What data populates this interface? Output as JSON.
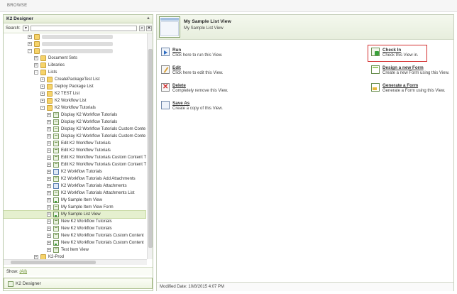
{
  "ribbon": {
    "label": "BROWSE"
  },
  "left_panel": {
    "title": "K2 Designer",
    "search_label": "Search:",
    "tree": [
      {
        "label": "",
        "kind": "folder",
        "indent": 1,
        "exp": "+",
        "blurred": true
      },
      {
        "label": "",
        "kind": "folder",
        "indent": 1,
        "exp": "+",
        "blurred": true
      },
      {
        "label": "",
        "kind": "folder",
        "indent": 1,
        "exp": "-",
        "blurred": true
      },
      {
        "label": "Document Sets",
        "kind": "folder",
        "indent": 2,
        "exp": "+"
      },
      {
        "label": "Libraries",
        "kind": "folder",
        "indent": 2,
        "exp": "+"
      },
      {
        "label": "Lists",
        "kind": "folder",
        "indent": 2,
        "exp": "-"
      },
      {
        "label": "CreatePackageTest List",
        "kind": "folder",
        "indent": 3,
        "exp": "+"
      },
      {
        "label": "Deploy Package List",
        "kind": "folder",
        "indent": 3,
        "exp": "+"
      },
      {
        "label": "K2 TEST List",
        "kind": "folder",
        "indent": 3,
        "exp": "+"
      },
      {
        "label": "K2 Workflow List",
        "kind": "folder",
        "indent": 3,
        "exp": "+"
      },
      {
        "label": "K2 Workflow Tutorials",
        "kind": "folder",
        "indent": 3,
        "exp": "-"
      },
      {
        "label": "Display K2 Workflow Tutorials",
        "kind": "view",
        "indent": 4,
        "exp": "+"
      },
      {
        "label": "Display K2 Workflow Tutorials",
        "kind": "view",
        "indent": 4,
        "exp": "+"
      },
      {
        "label": "Display K2 Workflow Tutorials Custom Conte",
        "kind": "view",
        "indent": 4,
        "exp": "+"
      },
      {
        "label": "Display K2 Workflow Tutorials Custom Conte",
        "kind": "view",
        "indent": 4,
        "exp": "+"
      },
      {
        "label": "Edit K2 Workflow Tutorials",
        "kind": "view",
        "indent": 4,
        "exp": "+"
      },
      {
        "label": "Edit K2 Workflow Tutorials",
        "kind": "view",
        "indent": 4,
        "exp": "+"
      },
      {
        "label": "Edit K2 Workflow Tutorials Custom Content T",
        "kind": "view",
        "indent": 4,
        "exp": "+"
      },
      {
        "label": "Edit K2 Workflow Tutorials Custom Content T",
        "kind": "view",
        "indent": 4,
        "exp": "+"
      },
      {
        "label": "K2 Workflow Tutorials",
        "kind": "smartobj",
        "indent": 4,
        "exp": "+"
      },
      {
        "label": "K2 Workflow Tutorials Add Attachments",
        "kind": "view",
        "indent": 4,
        "exp": "+"
      },
      {
        "label": "K2 Workflow Tutorials Attachments",
        "kind": "smartobj",
        "indent": 4,
        "exp": "+"
      },
      {
        "label": "K2 Workflow Tutorials Attachments List",
        "kind": "view",
        "indent": 4,
        "exp": "+"
      },
      {
        "label": "My Sample Item View",
        "kind": "form",
        "indent": 4,
        "exp": "+"
      },
      {
        "label": "My Sample Item View Form",
        "kind": "view",
        "indent": 4,
        "exp": "+"
      },
      {
        "label": "My Sample List View",
        "kind": "form",
        "indent": 4,
        "exp": "+",
        "selected": true
      },
      {
        "label": "New K2 Workflow Tutorials",
        "kind": "view",
        "indent": 4,
        "exp": "+"
      },
      {
        "label": "New K2 Workflow Tutorials",
        "kind": "view",
        "indent": 4,
        "exp": "+"
      },
      {
        "label": "New K2 Workflow Tutorials Custom Content",
        "kind": "view",
        "indent": 4,
        "exp": "+"
      },
      {
        "label": "New K2 Workflow Tutorials Custom Content",
        "kind": "form",
        "indent": 4,
        "exp": "+"
      },
      {
        "label": "Test Item View",
        "kind": "view",
        "indent": 4,
        "exp": "+"
      },
      {
        "label": "K2-Prod",
        "kind": "folder",
        "indent": 2,
        "exp": "+"
      }
    ],
    "show_label": "Show:",
    "show_link": "(All)",
    "designer_tab": "K2 Designer"
  },
  "right_panel": {
    "title": "My Sample List View",
    "subtitle": "My Sample List View",
    "actions_left": [
      {
        "title": "Run",
        "desc": "Click here to run this View.",
        "icon": "run"
      },
      {
        "title": "Edit",
        "desc": "Click here to edit this View.",
        "icon": "edit"
      },
      {
        "title": "Delete",
        "desc": "Completely remove this View.",
        "icon": "delete"
      },
      {
        "title": "Save As",
        "desc": "Create a copy of this View.",
        "icon": "saveas"
      }
    ],
    "actions_right": [
      {
        "title": "Check In",
        "desc": "Check this View in.",
        "icon": "checkin"
      },
      {
        "title": "Design a new Form",
        "desc": "Create a new Form using this View.",
        "icon": "design"
      },
      {
        "title": "Generate a Form",
        "desc": "Generate a Form using this View.",
        "icon": "generate"
      }
    ],
    "footer": "Modified Date: 10/8/2015 4:07 PM"
  },
  "colors": {
    "highlight": "#d32f2f",
    "selected_row": "#e5f0cf",
    "accent_green": "#6a8f2e"
  }
}
